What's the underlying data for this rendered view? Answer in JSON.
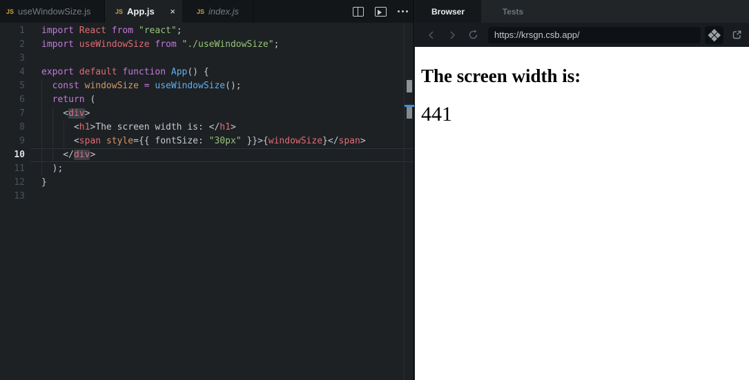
{
  "editor": {
    "tabs": [
      {
        "icon": "JS",
        "label": "useWindowSize.js",
        "state": "inactive"
      },
      {
        "icon": "JS",
        "label": "App.js",
        "state": "active",
        "close": "×"
      },
      {
        "icon": "JS",
        "label": "index.js",
        "state": "preview"
      }
    ],
    "code": {
      "active_line": 10,
      "lines": [
        [
          [
            "import",
            "k"
          ],
          [
            " ",
            "p"
          ],
          [
            "React",
            "r"
          ],
          [
            " ",
            "p"
          ],
          [
            "from",
            "k"
          ],
          [
            " ",
            "p"
          ],
          [
            "\"react\"",
            "g"
          ],
          [
            ";",
            "p"
          ]
        ],
        [
          [
            "import",
            "k"
          ],
          [
            " ",
            "p"
          ],
          [
            "useWindowSize",
            "r"
          ],
          [
            " ",
            "p"
          ],
          [
            "from",
            "k"
          ],
          [
            " ",
            "p"
          ],
          [
            "\"./useWindowSize\"",
            "g"
          ],
          [
            ";",
            "p"
          ]
        ],
        [],
        [
          [
            "export",
            "k"
          ],
          [
            " ",
            "p"
          ],
          [
            "default",
            "r"
          ],
          [
            " ",
            "p"
          ],
          [
            "function",
            "k"
          ],
          [
            " ",
            "p"
          ],
          [
            "App",
            "b"
          ],
          [
            "() {",
            "p"
          ]
        ],
        [
          [
            "  ",
            "p"
          ],
          [
            "const",
            "k"
          ],
          [
            " ",
            "p"
          ],
          [
            "windowSize",
            "o"
          ],
          [
            " ",
            "p"
          ],
          [
            "=",
            "k"
          ],
          [
            " ",
            "p"
          ],
          [
            "useWindowSize",
            "b"
          ],
          [
            "();",
            "p"
          ]
        ],
        [
          [
            "  ",
            "p"
          ],
          [
            "return",
            "k"
          ],
          [
            " (",
            "p"
          ]
        ],
        [
          [
            "    <",
            "p"
          ],
          [
            "div",
            "rh"
          ],
          [
            ">",
            "p"
          ]
        ],
        [
          [
            "      <",
            "p"
          ],
          [
            "h1",
            "r"
          ],
          [
            ">The screen width is: </",
            "p"
          ],
          [
            "h1",
            "r"
          ],
          [
            ">",
            "p"
          ]
        ],
        [
          [
            "      <",
            "p"
          ],
          [
            "span",
            "r"
          ],
          [
            " ",
            "p"
          ],
          [
            "style",
            "o"
          ],
          [
            "={{ fontSize: ",
            "p"
          ],
          [
            "\"30px\"",
            "g"
          ],
          [
            " }}>{",
            "p"
          ],
          [
            "windowSize",
            "r"
          ],
          [
            "}</",
            "p"
          ],
          [
            "span",
            "r"
          ],
          [
            ">",
            "p"
          ]
        ],
        [
          [
            "    </",
            "p"
          ],
          [
            "div",
            "rh"
          ],
          [
            ">",
            "p"
          ]
        ],
        [
          [
            "  );",
            "p"
          ]
        ],
        [
          [
            "}",
            "p"
          ]
        ],
        []
      ]
    }
  },
  "preview": {
    "tabs": [
      {
        "label": "Browser",
        "active": true
      },
      {
        "label": "Tests",
        "active": false
      }
    ],
    "url": "https://krsgn.csb.app/",
    "page": {
      "heading": "The screen width is:",
      "value": "441"
    }
  },
  "colors": {
    "keyword": "#c678dd",
    "tag_red": "#e06c75",
    "function_blue": "#61afef",
    "variable_orange": "#d19a66",
    "string_green": "#98c379",
    "plain": "#c5cad1",
    "line_number": "#4a525e",
    "active_line_number": "#dce1e7",
    "js_icon_gold": "#c9a53f",
    "cursor_marker_blue": "#3f8ed6",
    "preview_background": "#ffffff",
    "preview_text": "#000000"
  }
}
